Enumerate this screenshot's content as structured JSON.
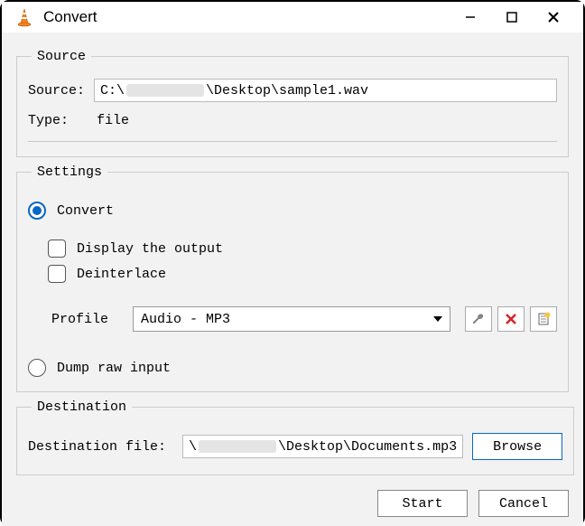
{
  "window": {
    "title": "Convert"
  },
  "source": {
    "legend": "Source",
    "source_label": "Source:",
    "source_prefix": "C:\\",
    "source_suffix": "\\Desktop\\sample1.wav",
    "type_label": "Type:",
    "type_value": "file"
  },
  "settings": {
    "legend": "Settings",
    "convert_label": "Convert",
    "display_output_label": "Display the output",
    "deinterlace_label": "Deinterlace",
    "profile_label": "Profile",
    "profile_value": "Audio - MP3",
    "dump_label": "Dump raw input"
  },
  "destination": {
    "legend": "Destination",
    "label": "Destination file:",
    "prefix": "\\",
    "suffix": "\\Desktop\\Documents.mp3",
    "browse_label": "Browse"
  },
  "footer": {
    "start_label": "Start",
    "cancel_label": "Cancel"
  }
}
